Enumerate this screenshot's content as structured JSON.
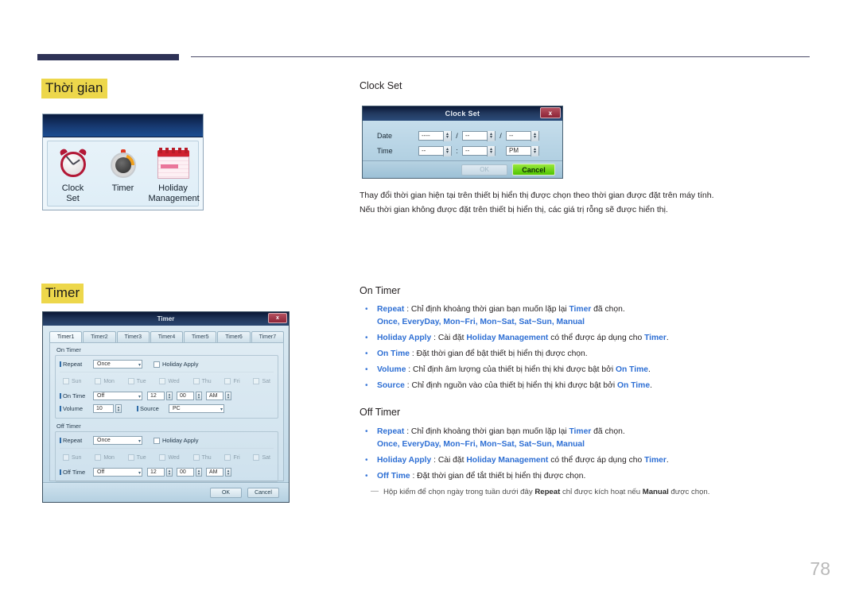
{
  "page": {
    "number": "78"
  },
  "sections": {
    "time_heading": "Thời gian",
    "timer_heading": "Timer"
  },
  "osd_menu": {
    "items": [
      {
        "label_line1": "Clock",
        "label_line2": "Set",
        "icon": "alarm-clock-icon"
      },
      {
        "label_line1": "Timer",
        "label_line2": "",
        "icon": "timer-dial-icon"
      },
      {
        "label_line1": "Holiday",
        "label_line2": "Management",
        "icon": "calendar-icon"
      }
    ]
  },
  "clock_set": {
    "caption": "Clock Set",
    "title": "Clock Set",
    "close_label": "x",
    "rows": [
      {
        "label": "Date",
        "f1": "----",
        "sep1": "/",
        "f2": "--",
        "sep2": "/",
        "f3": "--"
      },
      {
        "label": "Time",
        "f1": "--",
        "sep1": ":",
        "f2": "--",
        "sep2": "",
        "f3": "PM"
      }
    ],
    "ok_label": "OK",
    "cancel_label": "Cancel",
    "paragraphs": [
      "Thay đổi thời gian hiện tại trên thiết bị hiển thị được chọn theo thời gian được đặt trên máy tính.",
      "Nếu thời gian không được đặt trên thiết bị hiển thị, các giá trị rỗng sẽ được hiển thị."
    ]
  },
  "timer_dialog": {
    "title": "Timer",
    "close_label": "x",
    "tabs": [
      {
        "label": "Timer1",
        "selected": true
      },
      {
        "label": "Timer2",
        "selected": false
      },
      {
        "label": "Timer3",
        "selected": false
      },
      {
        "label": "Timer4",
        "selected": false
      },
      {
        "label": "Timer5",
        "selected": false
      },
      {
        "label": "Timer6",
        "selected": false
      },
      {
        "label": "Timer7",
        "selected": false
      }
    ],
    "on_group": {
      "title": "On Timer",
      "repeat_label": "Repeat",
      "repeat_value": "Once",
      "holiday_apply_label": "Holiday Apply",
      "days": [
        "Sun",
        "Mon",
        "Tue",
        "Wed",
        "Thu",
        "Fri",
        "Sat"
      ],
      "ontime_label": "On Time",
      "ontime_value": "Off",
      "hour": "12",
      "minute": "00",
      "ampm": "AM",
      "volume_label": "Volume",
      "volume_value": "10",
      "source_label": "Source",
      "source_value": "PC"
    },
    "off_group": {
      "title": "Off Timer",
      "repeat_label": "Repeat",
      "repeat_value": "Once",
      "holiday_apply_label": "Holiday Apply",
      "days": [
        "Sun",
        "Mon",
        "Tue",
        "Wed",
        "Thu",
        "Fri",
        "Sat"
      ],
      "offtime_label": "Off Time",
      "offtime_value": "Off",
      "hour": "12",
      "minute": "00",
      "ampm": "AM"
    },
    "ok_label": "OK",
    "cancel_label": "Cancel"
  },
  "on_timer": {
    "caption": "On Timer",
    "bullets": [
      {
        "key": "Repeat",
        "text": " : Chỉ định khoảng thời gian bạn muốn lặp lại ",
        "key2": "Timer",
        "tail": " đã chọn.",
        "options": "Once, EveryDay, Mon~Fri, Mon~Sat, Sat~Sun, Manual"
      },
      {
        "key": "Holiday Apply",
        "text": " : Cài đặt ",
        "key2": "Holiday Management",
        "mid": " có thể được áp dụng cho ",
        "key3": "Timer",
        "tail": "."
      },
      {
        "key": "On Time",
        "text": " : Đặt thời gian để bật thiết bị hiển thị được chọn."
      },
      {
        "key": "Volume",
        "text": " : Chỉ định âm lượng của thiết bị hiển thị khi được bật bởi ",
        "key2": "On Time",
        "tail": "."
      },
      {
        "key": "Source",
        "text": " : Chỉ định nguồn vào của thiết bị hiển thị khi được bật bởi ",
        "key2": "On Time",
        "tail": "."
      }
    ]
  },
  "off_timer": {
    "caption": "Off Timer",
    "bullets": [
      {
        "key": "Repeat",
        "text": " : Chỉ định khoảng thời gian bạn muốn lặp lại ",
        "key2": "Timer",
        "tail": " đã chọn.",
        "options": "Once, EveryDay, Mon~Fri, Mon~Sat, Sat~Sun, Manual"
      },
      {
        "key": "Holiday Apply",
        "text": " : Cài đặt ",
        "key2": "Holiday Management",
        "mid": " có thể được áp dụng cho ",
        "key3": "Timer",
        "tail": "."
      },
      {
        "key": "Off Time",
        "text": " : Đặt thời gian để tắt thiết bị hiển thị được chọn."
      }
    ],
    "note": {
      "p1": "Hộp kiểm để chọn ngày trong tuần dưới đây ",
      "b1": "Repeat",
      "p2": " chỉ được kích hoạt nếu ",
      "b2": "Manual",
      "p3": " được chọn."
    }
  },
  "colors": {
    "highlight": "#edd74b",
    "link_blue": "#2e6fd4",
    "header_bar": "#2e3256",
    "cancel_green": "#4fc400"
  }
}
